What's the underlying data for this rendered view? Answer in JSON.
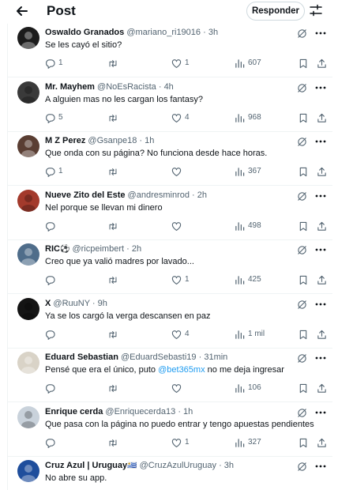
{
  "header": {
    "title": "Post",
    "reply_button": "Responder"
  },
  "tweets": [
    {
      "name": "Oswaldo Granados",
      "handle": "@mariano_ri19016",
      "time": "3h",
      "text": "Se les cayó el sitio?",
      "replies": "1",
      "reposts": "",
      "likes": "1",
      "views": "607",
      "avatar_color": "#1c1c1c"
    },
    {
      "name": "Mr. Mayhem",
      "handle": "@NoEsRacista",
      "time": "4h",
      "text": "A alguien mas no les cargan los fantasy?",
      "replies": "5",
      "reposts": "",
      "likes": "4",
      "views": "968",
      "avatar_color": "#3a3a3a"
    },
    {
      "name": "M Z Perez",
      "handle": "@Gsanpe18",
      "time": "1h",
      "text": "Que onda con su página? No funciona desde hace horas.",
      "replies": "1",
      "reposts": "",
      "likes": "",
      "views": "367",
      "avatar_color": "#5a3e33"
    },
    {
      "name": "Nueve Zito del Este",
      "handle": "@andresminrod",
      "time": "2h",
      "text": "Nel porque se llevan mi dinero",
      "replies": "",
      "reposts": "",
      "likes": "",
      "views": "498",
      "avatar_color": "#a33a2c"
    },
    {
      "name": "RIC",
      "name_emoji": "⚽",
      "handle": "@ricpeimbert",
      "time": "2h",
      "text": "Creo que ya valió madres por lavado...",
      "replies": "",
      "reposts": "",
      "likes": "1",
      "views": "425",
      "avatar_color": "#4f6d8a"
    },
    {
      "name": "X",
      "handle": "@RuuNY",
      "time": "9h",
      "text": "Ya se los cargó la verga descansen en paz",
      "replies": "",
      "reposts": "",
      "likes": "4",
      "views": "1 mil",
      "avatar_color": "#141414"
    },
    {
      "name": "Eduard Sebastian",
      "handle": "@EduardSebasti19",
      "time": "31min",
      "text_before": "Pensé que era el único, puto ",
      "mention": "@bet365mx",
      "text_after": " no me deja ingresar",
      "replies": "",
      "reposts": "",
      "likes": "",
      "views": "106",
      "avatar_color": "#d9d3c7"
    },
    {
      "name": "Enrique cerda",
      "handle": "@Enriquecerda13",
      "time": "1h",
      "text": "Que pasa con la página no puedo entrar y tengo apuestas pendientes",
      "replies": "",
      "reposts": "",
      "likes": "1",
      "views": "327",
      "avatar_color": "#c9d2db"
    },
    {
      "name": "Cruz Azul | Uruguay",
      "name_emoji": "🇺🇾",
      "handle": "@CruzAzulUruguay",
      "time": "3h",
      "text": "No abre su app.",
      "replies": "",
      "reposts": "",
      "likes": "",
      "views": "",
      "avatar_color": "#1f4e9c"
    }
  ],
  "icons": {
    "back": "arrow-left-icon",
    "settings": "sliders-icon",
    "reply": "comment-icon",
    "repost": "repost-icon",
    "like": "heart-icon",
    "views": "bar-chart-icon",
    "bookmark": "bookmark-icon",
    "share": "share-icon",
    "grok": "grok-icon",
    "more": "more-icon"
  },
  "colors": {
    "text": "#0f1419",
    "muted": "#536471",
    "link": "#1d9bf0",
    "border": "#eff3f4"
  }
}
